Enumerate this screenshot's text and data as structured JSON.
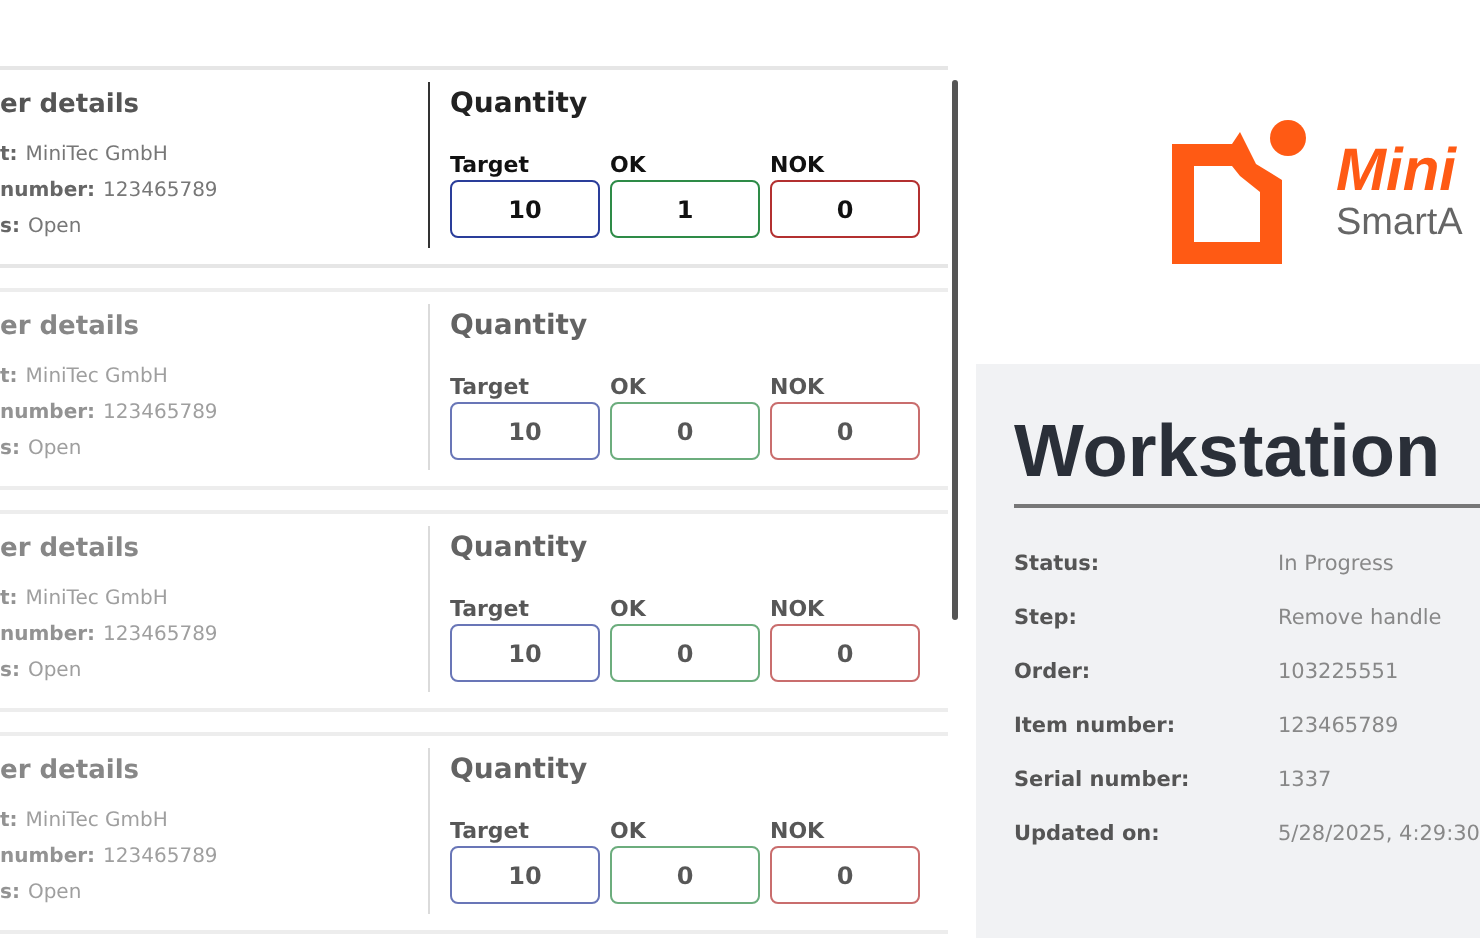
{
  "orders": [
    {
      "active": true,
      "title": "er details",
      "fields": [
        {
          "label": "t:",
          "value": "MiniTec GmbH"
        },
        {
          "label": "number:",
          "value": "123465789"
        },
        {
          "label": "s:",
          "value": "Open"
        }
      ],
      "quantity": {
        "title": "Quantity",
        "items": [
          {
            "kind": "target",
            "label": "Target",
            "value": "10"
          },
          {
            "kind": "ok",
            "label": "OK",
            "value": "1"
          },
          {
            "kind": "nok",
            "label": "NOK",
            "value": "0"
          }
        ]
      }
    },
    {
      "active": false,
      "title": "er details",
      "fields": [
        {
          "label": "t:",
          "value": "MiniTec GmbH"
        },
        {
          "label": "number:",
          "value": "123465789"
        },
        {
          "label": "s:",
          "value": "Open"
        }
      ],
      "quantity": {
        "title": "Quantity",
        "items": [
          {
            "kind": "target",
            "label": "Target",
            "value": "10"
          },
          {
            "kind": "ok",
            "label": "OK",
            "value": "0"
          },
          {
            "kind": "nok",
            "label": "NOK",
            "value": "0"
          }
        ]
      }
    },
    {
      "active": false,
      "title": "er details",
      "fields": [
        {
          "label": "t:",
          "value": "MiniTec GmbH"
        },
        {
          "label": "number:",
          "value": "123465789"
        },
        {
          "label": "s:",
          "value": "Open"
        }
      ],
      "quantity": {
        "title": "Quantity",
        "items": [
          {
            "kind": "target",
            "label": "Target",
            "value": "10"
          },
          {
            "kind": "ok",
            "label": "OK",
            "value": "0"
          },
          {
            "kind": "nok",
            "label": "NOK",
            "value": "0"
          }
        ]
      }
    },
    {
      "active": false,
      "title": "er details",
      "fields": [
        {
          "label": "t:",
          "value": "MiniTec GmbH"
        },
        {
          "label": "number:",
          "value": "123465789"
        },
        {
          "label": "s:",
          "value": "Open"
        }
      ],
      "quantity": {
        "title": "Quantity",
        "items": [
          {
            "kind": "target",
            "label": "Target",
            "value": "10"
          },
          {
            "kind": "ok",
            "label": "OK",
            "value": "0"
          },
          {
            "kind": "nok",
            "label": "NOK",
            "value": "0"
          }
        ]
      }
    }
  ],
  "logo": {
    "brand": "Mini",
    "product": "SmartA"
  },
  "workstation": {
    "title": "Workstation",
    "rows": [
      {
        "label": "Status:",
        "value": "In Progress"
      },
      {
        "label": "Step:",
        "value": "Remove handle"
      },
      {
        "label": "Order:",
        "value": "103225551"
      },
      {
        "label": "Item number:",
        "value": "123465789"
      },
      {
        "label": "Serial number:",
        "value": "1337"
      },
      {
        "label": "Updated on:",
        "value": "5/28/2025, 4:29:30"
      }
    ]
  }
}
